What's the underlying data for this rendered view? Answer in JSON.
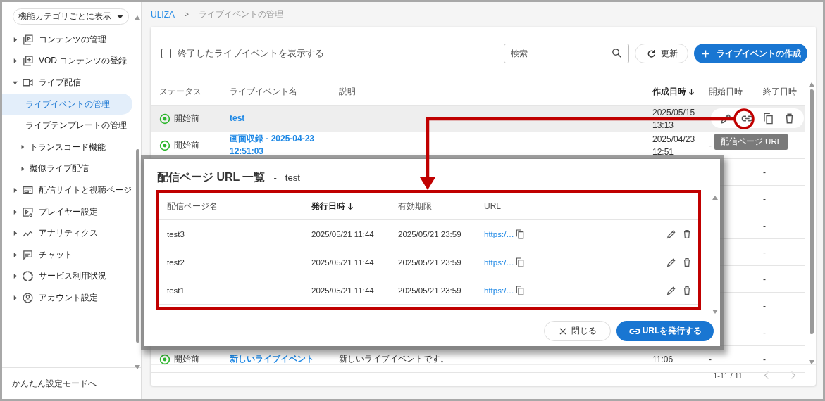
{
  "sidebar": {
    "filter_button": "機能カテゴリごとに表示",
    "items": [
      {
        "label": "コンテンツの管理",
        "expanded": false,
        "selected": false
      },
      {
        "label": "VOD コンテンツの登録",
        "expanded": false,
        "selected": false
      },
      {
        "label": "ライブ配信",
        "expanded": true,
        "selected": false,
        "children": [
          {
            "label": "ライブイベントの管理",
            "selected": true
          },
          {
            "label": "ライブテンプレートの管理",
            "selected": false
          },
          {
            "label": "トランスコード機能",
            "selected": false,
            "expanded": false
          },
          {
            "label": "擬似ライブ配信",
            "selected": false,
            "expanded": false
          }
        ]
      },
      {
        "label": "配信サイトと視聴ページ",
        "expanded": false,
        "selected": false
      },
      {
        "label": "プレイヤー設定",
        "expanded": false,
        "selected": false
      },
      {
        "label": "アナリティクス",
        "expanded": false,
        "selected": false
      },
      {
        "label": "チャット",
        "expanded": false,
        "selected": false
      },
      {
        "label": "サービス利用状況",
        "expanded": false,
        "selected": false
      },
      {
        "label": "アカウント設定",
        "expanded": false,
        "selected": false
      }
    ],
    "footer_link": "かんたん設定モードへ"
  },
  "breadcrumb": {
    "items": [
      "ULIZA",
      "ライブイベントの管理"
    ],
    "separator": ">"
  },
  "toolbar": {
    "show_ended": {
      "label": "終了したライブイベントを表示する",
      "checked": false
    },
    "search": {
      "placeholder": "検索"
    },
    "refresh_button": "更新",
    "create_button": "ライブイベントの作成"
  },
  "events": {
    "columns": [
      {
        "label": "ステータス",
        "sorted": false
      },
      {
        "label": "ライブイベント名",
        "sorted": false
      },
      {
        "label": "説明",
        "sorted": false
      },
      {
        "label": "作成日時",
        "sorted": true
      },
      {
        "label": "開始日時",
        "sorted": false
      },
      {
        "label": "終了日時",
        "sorted": false
      }
    ],
    "rows": [
      {
        "status": "開始前",
        "name": "test",
        "created": "2025/05/15 13:13",
        "hovered": true
      },
      {
        "status": "開始前",
        "name": "画面収録 - 2025-04-23 12:51:03",
        "created": "2025/04/23 12:51",
        "start": "-",
        "hovered": false
      },
      {
        "end": "-",
        "hovered": false
      },
      {
        "end": "-",
        "hovered": false
      },
      {
        "end": "-",
        "hovered": false
      },
      {
        "end": "-",
        "hovered": false
      },
      {
        "end": "-",
        "hovered": false
      },
      {
        "end": "-",
        "hovered": false
      },
      {
        "end": "-",
        "hovered": false
      },
      {
        "status": "開始前",
        "name": "新しいライブイベント",
        "description": "新しいライブイベントです。",
        "created": "11:06",
        "start": "-",
        "end": "-",
        "hovered": false
      }
    ],
    "tooltip": "配信ページ URL",
    "pagination": "1-11 / 11"
  },
  "modal": {
    "title": "配信ページ URL 一覧",
    "separator": "-",
    "subject": "test",
    "columns": [
      {
        "label": "配信ページ名",
        "sorted": false
      },
      {
        "label": "発行日時",
        "sorted": true
      },
      {
        "label": "有効期限",
        "sorted": false
      },
      {
        "label": "URL",
        "sorted": false
      }
    ],
    "rows": [
      {
        "name": "test3",
        "issued": "2025/05/21 11:44",
        "expires": "2025/05/21 23:59",
        "url": "https:/…"
      },
      {
        "name": "test2",
        "issued": "2025/05/21 11:44",
        "expires": "2025/05/21 23:59",
        "url": "https:/…"
      },
      {
        "name": "test1",
        "issued": "2025/05/21 11:44",
        "expires": "2025/05/21 23:59",
        "url": "https:/…"
      }
    ],
    "close_button": "閉じる",
    "issue_button": "URLを発行する"
  }
}
